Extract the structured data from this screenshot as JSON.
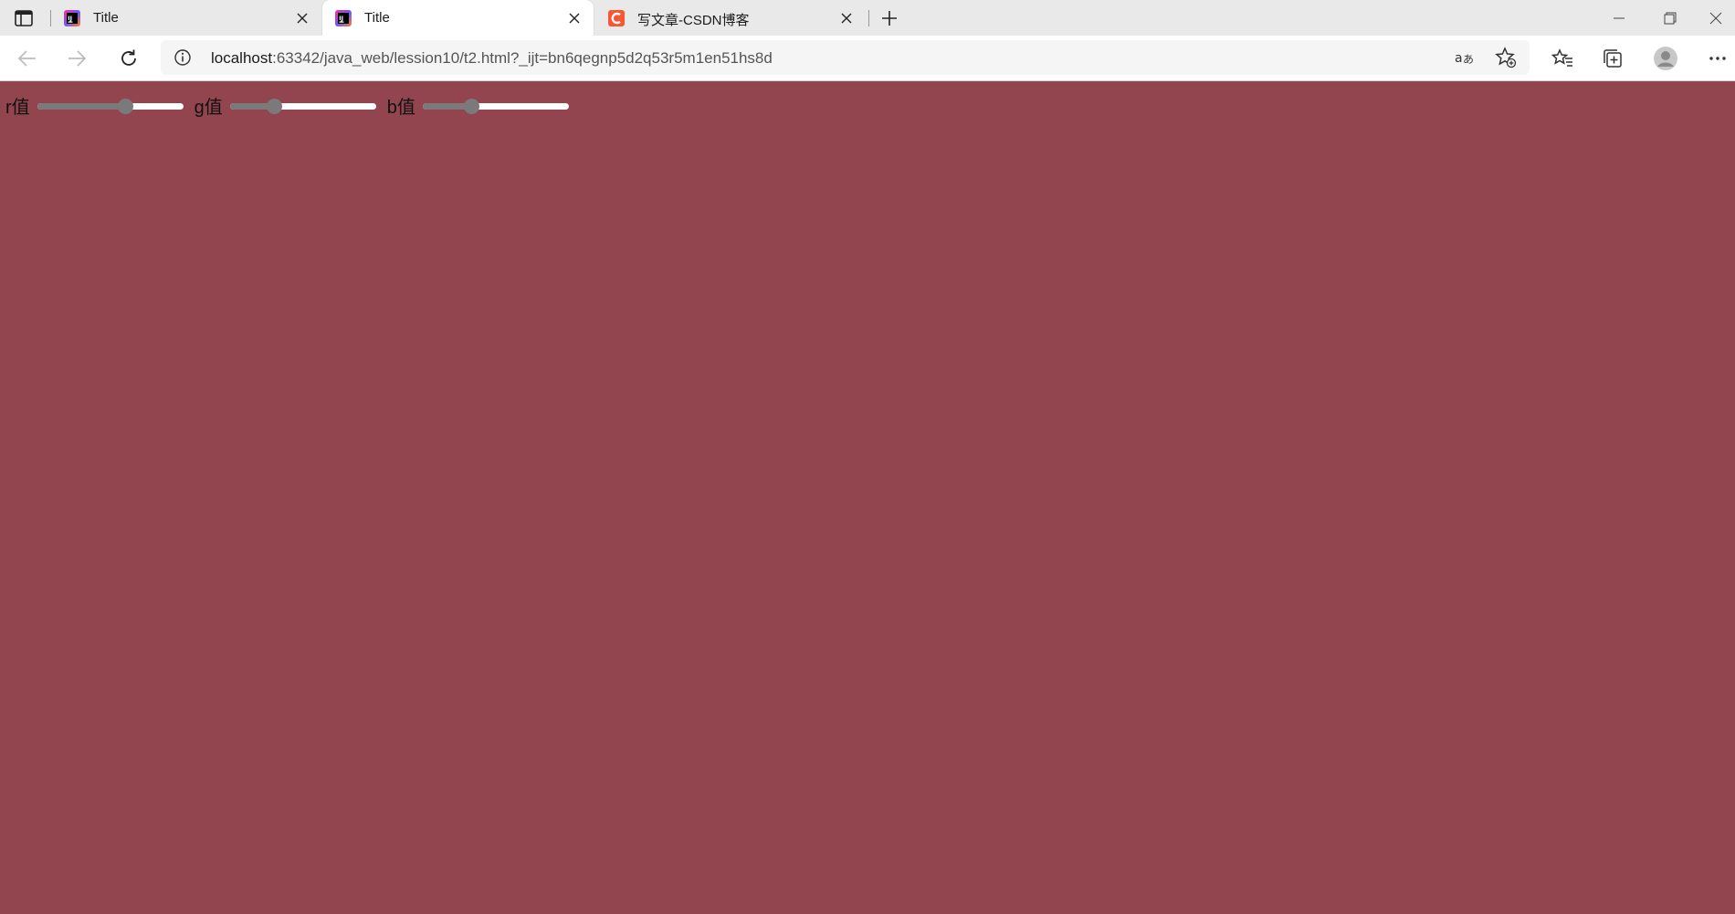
{
  "tabs": [
    {
      "title": "Title",
      "active": false
    },
    {
      "title": "Title",
      "active": true
    },
    {
      "title": "写文章-CSDN博客",
      "active": false
    }
  ],
  "address": {
    "host": "localhost",
    "rest": ":63342/java_web/lession10/t2.html?_ijt=bn6qegnp5d2q53r5m1en51hs8d"
  },
  "page": {
    "background": "#93454f",
    "sliders": [
      {
        "label": "r值",
        "value": 0.6
      },
      {
        "label": "g值",
        "value": 0.3
      },
      {
        "label": "b值",
        "value": 0.33
      }
    ]
  },
  "colors": {
    "csdn_brand": "#fc5531"
  }
}
